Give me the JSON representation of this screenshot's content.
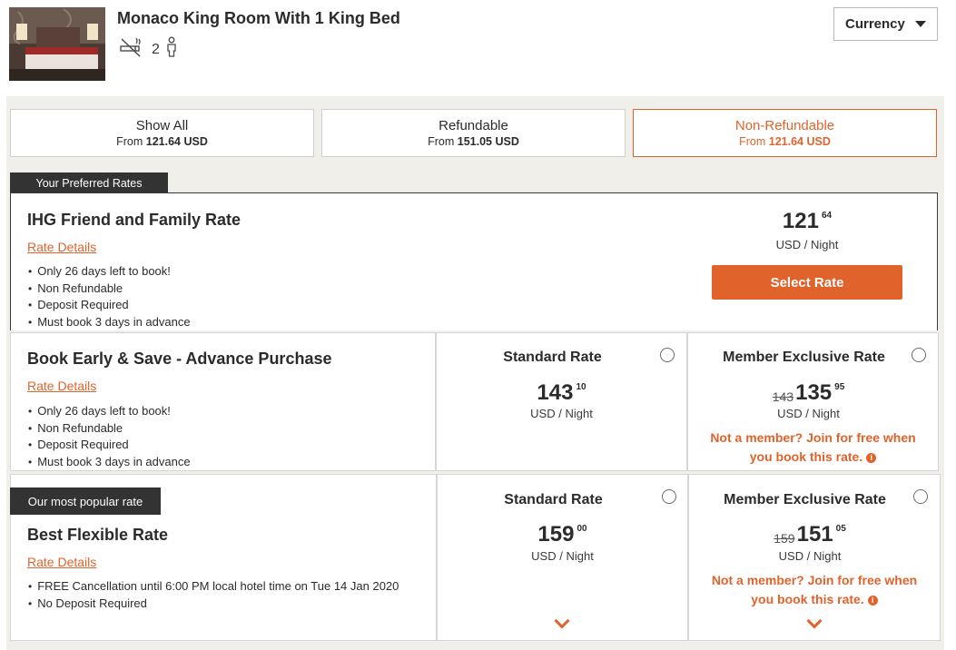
{
  "room": {
    "title": "Monaco King Room With 1 King Bed",
    "occupancy": "2",
    "icons": [
      "no-smoking-icon",
      "person-icon"
    ]
  },
  "currency": {
    "label": "Currency"
  },
  "tabs": [
    {
      "label": "Show All",
      "from_prefix": "From",
      "from_value": "121.64 USD",
      "active": false
    },
    {
      "label": "Refundable",
      "from_prefix": "From",
      "from_value": "151.05 USD",
      "active": false
    },
    {
      "label": "Non-Refundable",
      "from_prefix": "From",
      "from_value": "121.64 USD",
      "active": true
    }
  ],
  "preferred": {
    "tag": "Your Preferred Rates",
    "name": "IHG Friend and Family Rate",
    "details_link": "Rate Details",
    "bullets": [
      "Only 26 days left to book!",
      "Non Refundable",
      "Deposit Required",
      "Must book 3 days in advance"
    ],
    "price_whole": "121",
    "price_cents": "64",
    "per_night": "USD / Night",
    "select_label": "Select Rate"
  },
  "advance": {
    "name": "Book Early & Save - Advance Purchase",
    "details_link": "Rate Details",
    "bullets": [
      "Only 26 days left to book!",
      "Non Refundable",
      "Deposit Required",
      "Must book 3 days in advance"
    ],
    "standard": {
      "title": "Standard Rate",
      "price_whole": "143",
      "price_cents": "10",
      "per_night": "USD / Night"
    },
    "member": {
      "title": "Member Exclusive Rate",
      "strike": "143",
      "price_whole": "135",
      "price_cents": "95",
      "per_night": "USD / Night",
      "msg_line1": "Not a member? Join for free when",
      "msg_line2": "you book this rate."
    }
  },
  "flexible": {
    "tag": "Our most popular rate",
    "name": "Best Flexible Rate",
    "details_link": "Rate Details",
    "bullets": [
      "FREE Cancellation until 6:00 PM local hotel time on Tue 14 Jan 2020",
      "No Deposit Required"
    ],
    "standard": {
      "title": "Standard Rate",
      "price_whole": "159",
      "price_cents": "00",
      "per_night": "USD / Night"
    },
    "member": {
      "title": "Member Exclusive Rate",
      "strike": "159",
      "price_whole": "151",
      "price_cents": "05",
      "per_night": "USD / Night",
      "msg_line1": "Not a member? Join for free when",
      "msg_line2": "you book this rate."
    }
  },
  "colors": {
    "accent": "#e1632c",
    "panel": "#f1efe9",
    "dark_tag": "#333333"
  }
}
